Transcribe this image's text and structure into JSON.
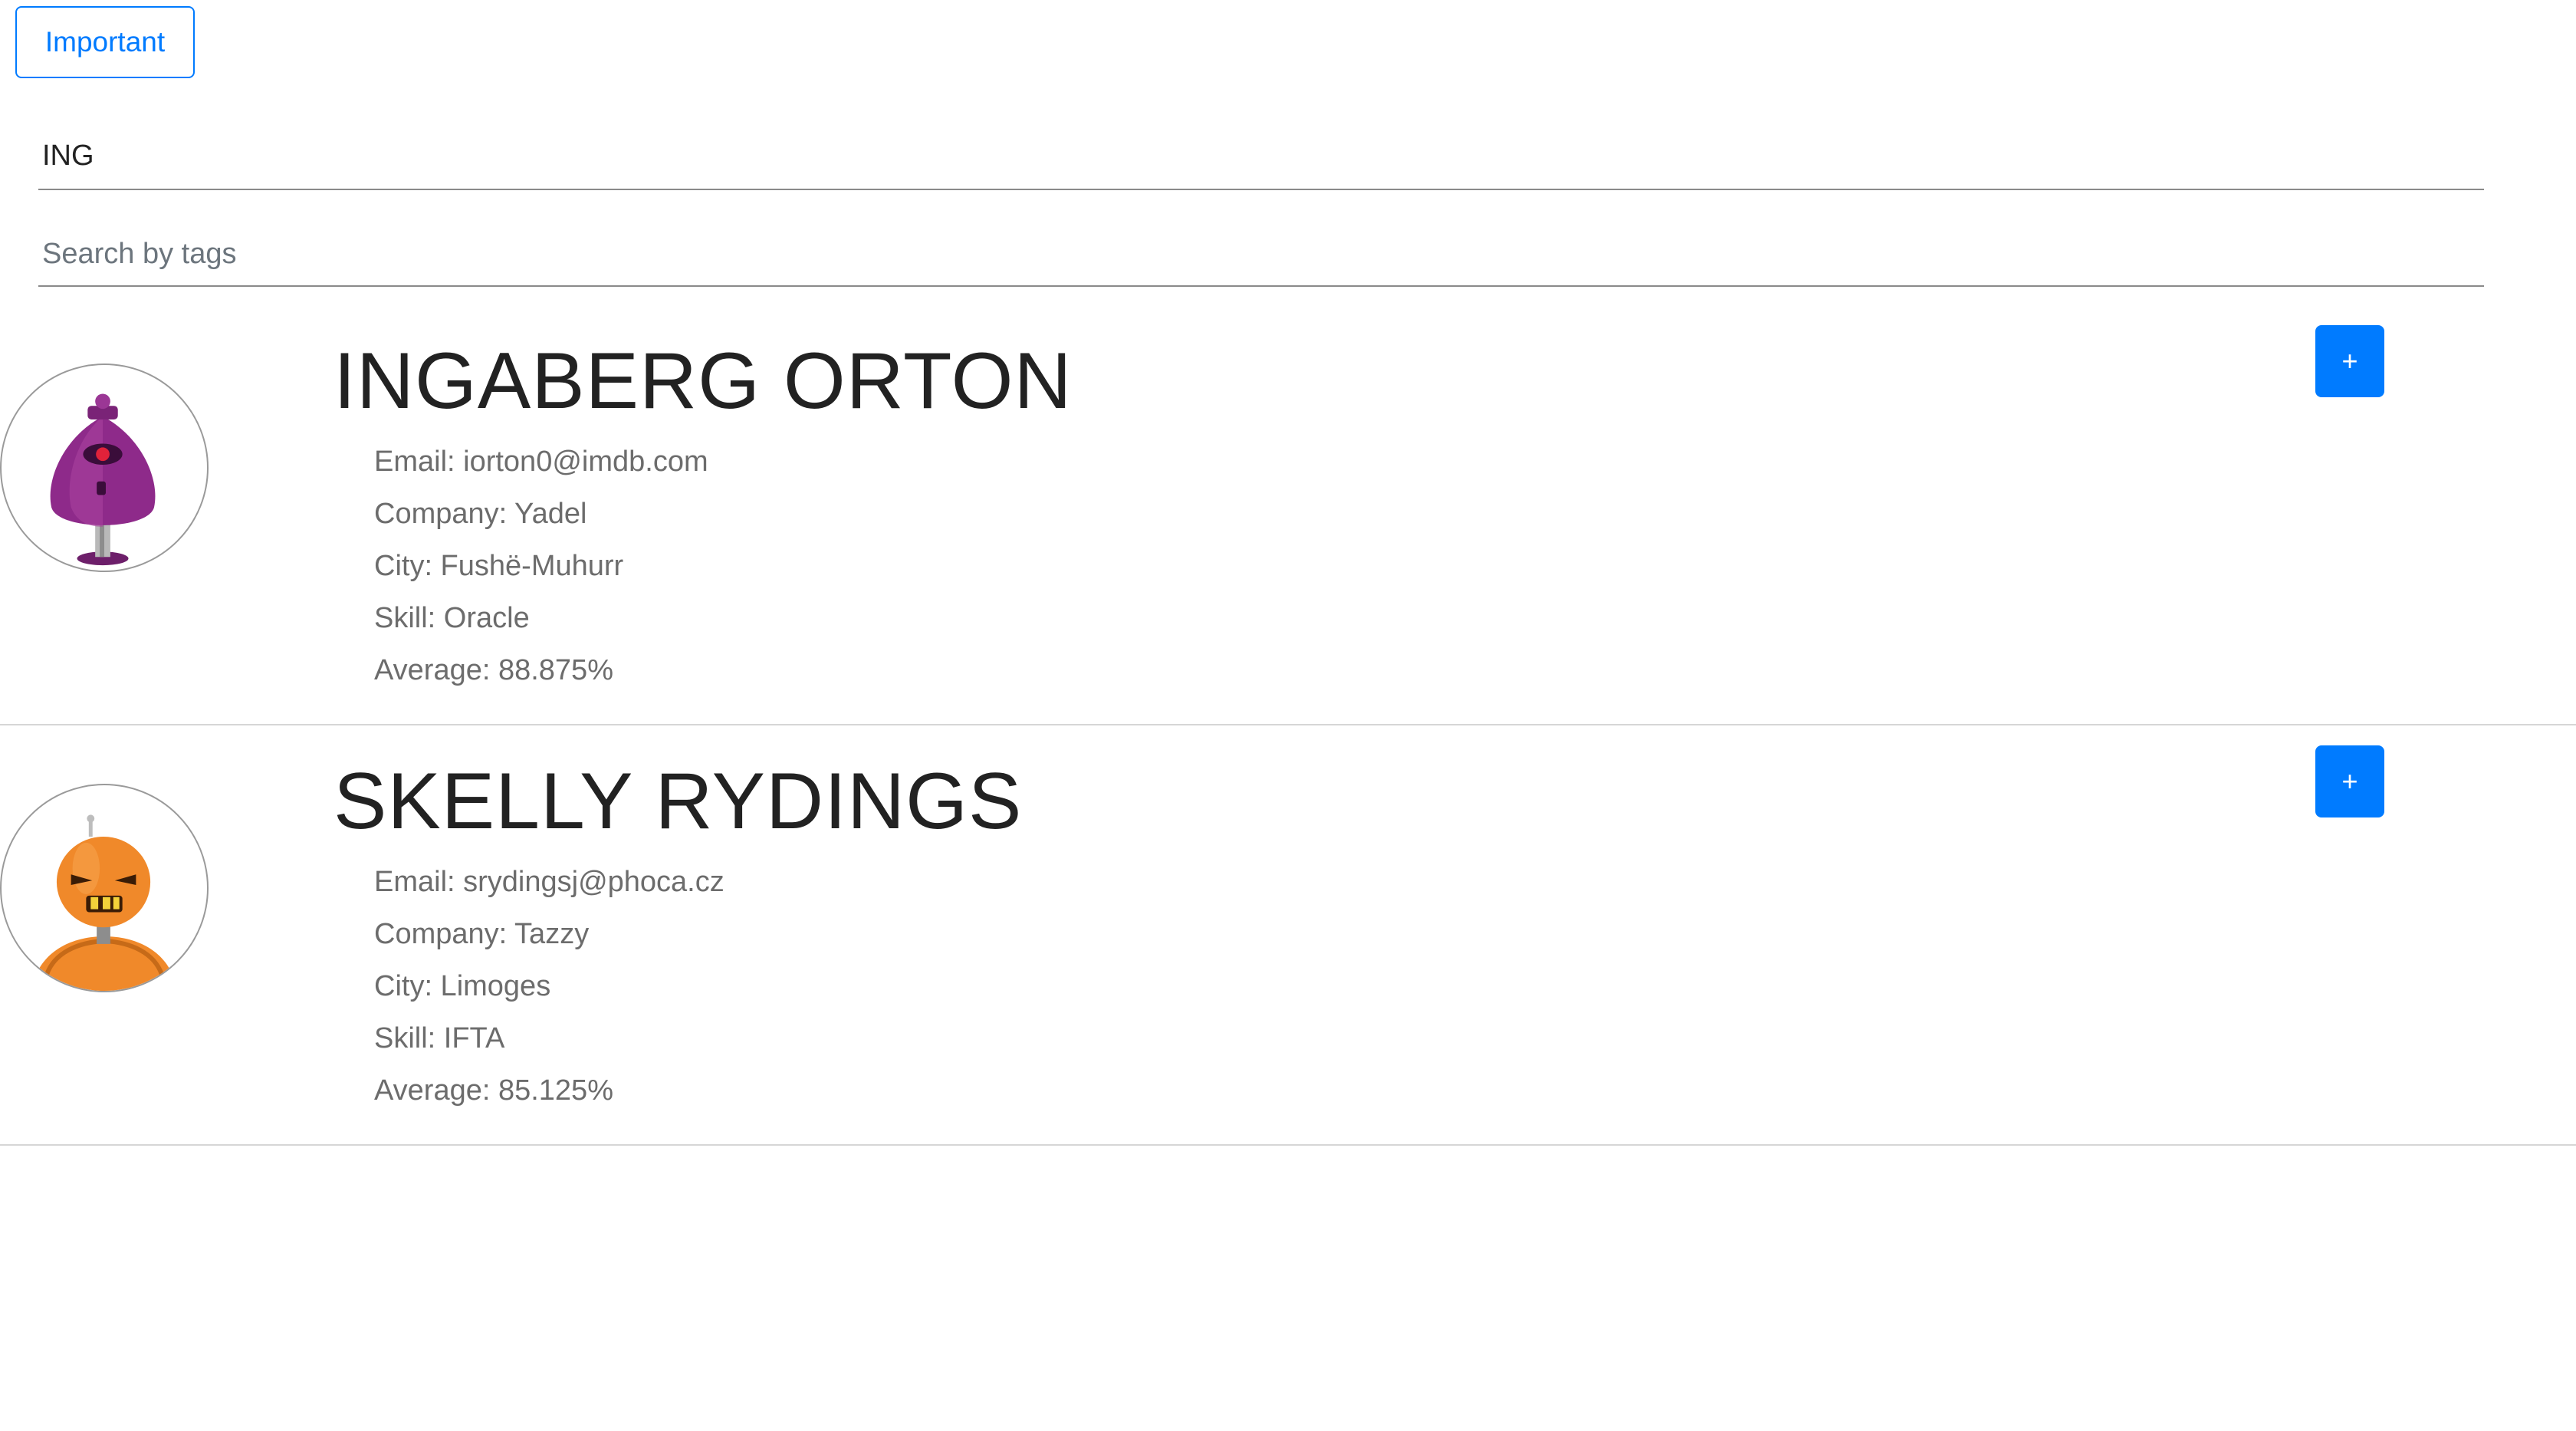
{
  "toolbar": {
    "important_label": "Important"
  },
  "filters": {
    "name_value": "ING",
    "tag_placeholder": "Search by tags"
  },
  "students": [
    {
      "name": "INGABERG ORTON",
      "email": "Email: iorton0@imdb.com",
      "company": "Company: Yadel",
      "city": "City: Fushë-Muhurr",
      "skill": "Skill: Oracle",
      "average": "Average: 88.875%",
      "add_label": "+",
      "avatar_icon": "purple-robot-avatar",
      "avatar_color": "#8e2a8a"
    },
    {
      "name": "SKELLY RYDINGS",
      "email": "Email: srydingsj@phoca.cz",
      "company": "Company: Tazzy",
      "city": "City: Limoges",
      "skill": "Skill: IFTA",
      "average": "Average: 85.125%",
      "add_label": "+",
      "avatar_icon": "orange-robot-avatar",
      "avatar_color": "#f0892a"
    }
  ],
  "colors": {
    "primary": "#007bff",
    "text": "#222222",
    "muted": "#6c6c6c"
  }
}
